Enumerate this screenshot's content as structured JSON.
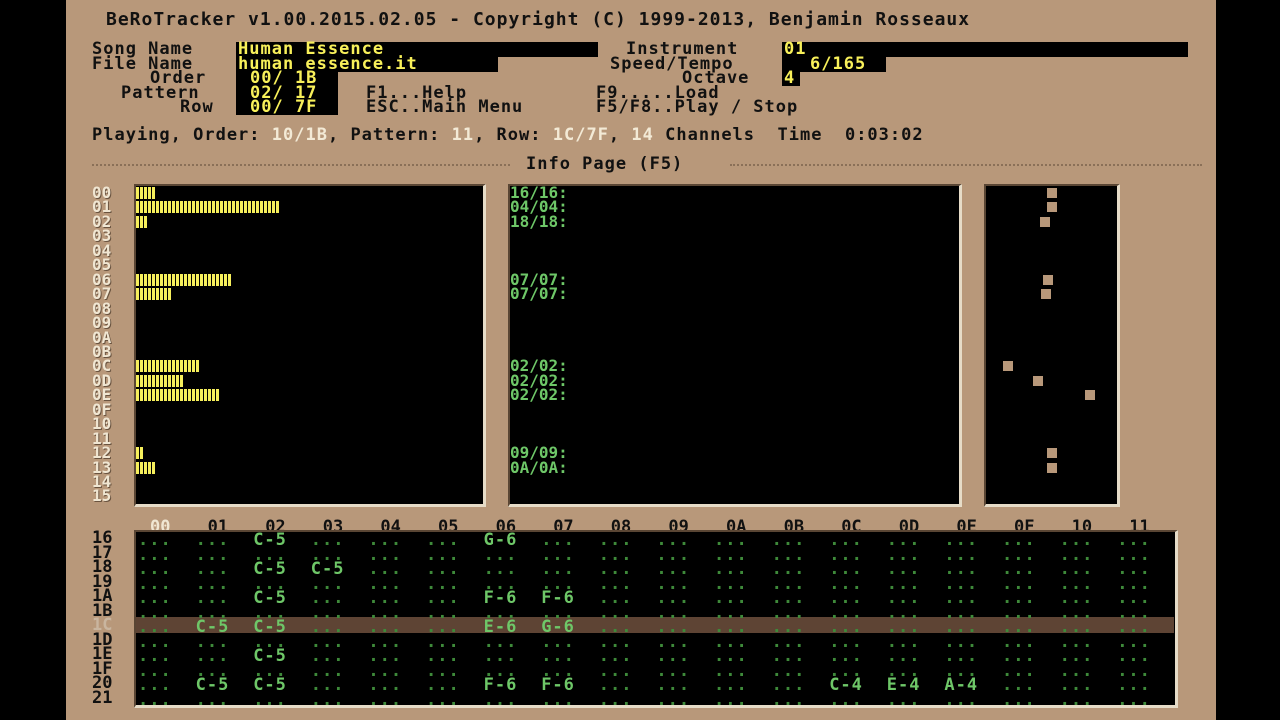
{
  "title": "BeRoTracker v1.00.2015.02.05 - Copyright (C) 1999-2013, Benjamin Rosseaux",
  "fields": {
    "song_name_label": "Song Name",
    "song_name": "Human Essence",
    "file_name_label": "File Name",
    "file_name": "human essence.it",
    "order_label": "Order",
    "order_value": "00/ 1B",
    "pattern_label": "Pattern",
    "pattern_value": "02/ 17",
    "row_label": "Row",
    "row_value": "00/ 7F",
    "instrument_label": "Instrument",
    "instrument_value": "01",
    "speed_label": "Speed/Tempo",
    "speed_value": "6/165",
    "octave_label": "Octave",
    "octave_value": "4"
  },
  "shortcuts": {
    "f1": "F1...Help",
    "esc": "ESC..Main Menu",
    "f9": "F9.....Load",
    "f5f8": "F5/F8..Play / Stop"
  },
  "status": {
    "playing_label": "Playing, Order:",
    "order": "10/1B",
    "pattern_label": ", Pattern:",
    "pattern": "11",
    "row_label": ", Row:",
    "row": "1C/7F",
    "channels_count": "14",
    "channels_label": "Channels",
    "time_label": "Time",
    "time": "0:03:02"
  },
  "info_page_title": "Info Page (F5)",
  "channel_rows": [
    "00",
    "01",
    "02",
    "03",
    "04",
    "05",
    "06",
    "07",
    "08",
    "09",
    "0A",
    "0B",
    "0C",
    "0D",
    "0E",
    "0F",
    "10",
    "11",
    "12",
    "13",
    "14",
    "15"
  ],
  "vu_levels": [
    5,
    36,
    3,
    0,
    0,
    0,
    24,
    9,
    0,
    0,
    0,
    0,
    16,
    12,
    21,
    0,
    0,
    0,
    2,
    5,
    0,
    0
  ],
  "vu_texts": [
    "16/16:",
    "04/04:",
    "18/18:",
    "",
    "",
    "",
    "07/07:",
    "07/07:",
    "",
    "",
    "",
    "",
    "02/02:",
    "02/02:",
    "02/02:",
    "",
    "",
    "",
    "09/09:",
    "0A/0A:",
    "",
    ""
  ],
  "pan_positions": [
    0.51,
    0.51,
    0.45,
    null,
    null,
    null,
    0.48,
    0.46,
    null,
    null,
    null,
    null,
    0.17,
    0.4,
    0.8,
    null,
    null,
    null,
    0.51,
    0.51,
    null,
    null
  ],
  "pattern": {
    "channels": [
      "00",
      "01",
      "02",
      "03",
      "04",
      "05",
      "06",
      "07",
      "08",
      "09",
      "0A",
      "0B",
      "0C",
      "0D",
      "0E",
      "0F",
      "10",
      "11"
    ],
    "rows": [
      "16",
      "17",
      "18",
      "19",
      "1A",
      "1B",
      "1C",
      "1D",
      "1E",
      "1F",
      "20",
      "21"
    ],
    "current_row": "1C",
    "cells": [
      [
        "...",
        "...",
        "C-5",
        "...",
        "...",
        "...",
        "G-6",
        "...",
        "...",
        "...",
        "...",
        "...",
        "...",
        "...",
        "...",
        "...",
        "...",
        "..."
      ],
      [
        "...",
        "...",
        "...",
        "...",
        "...",
        "...",
        "...",
        "...",
        "...",
        "...",
        "...",
        "...",
        "...",
        "...",
        "...",
        "...",
        "...",
        "..."
      ],
      [
        "...",
        "...",
        "C-5",
        "C-5",
        "...",
        "...",
        "...",
        "...",
        "...",
        "...",
        "...",
        "...",
        "...",
        "...",
        "...",
        "...",
        "...",
        "..."
      ],
      [
        "...",
        "...",
        "...",
        "...",
        "...",
        "...",
        "...",
        "...",
        "...",
        "...",
        "...",
        "...",
        "...",
        "...",
        "...",
        "...",
        "...",
        "..."
      ],
      [
        "...",
        "...",
        "C-5",
        "...",
        "...",
        "...",
        "F-6",
        "F-6",
        "...",
        "...",
        "...",
        "...",
        "...",
        "...",
        "...",
        "...",
        "...",
        "..."
      ],
      [
        "...",
        "...",
        "...",
        "...",
        "...",
        "...",
        "...",
        "...",
        "...",
        "...",
        "...",
        "...",
        "...",
        "...",
        "...",
        "...",
        "...",
        "..."
      ],
      [
        "...",
        "C-5",
        "C-5",
        "...",
        "...",
        "...",
        "E-6",
        "G-6",
        "...",
        "...",
        "...",
        "...",
        "...",
        "...",
        "...",
        "...",
        "...",
        "..."
      ],
      [
        "...",
        "...",
        "...",
        "...",
        "...",
        "...",
        "...",
        "...",
        "...",
        "...",
        "...",
        "...",
        "...",
        "...",
        "...",
        "...",
        "...",
        "..."
      ],
      [
        "...",
        "...",
        "C-5",
        "...",
        "...",
        "...",
        "...",
        "...",
        "...",
        "...",
        "...",
        "...",
        "...",
        "...",
        "...",
        "...",
        "...",
        "..."
      ],
      [
        "...",
        "...",
        "...",
        "...",
        "...",
        "...",
        "...",
        "...",
        "...",
        "...",
        "...",
        "...",
        "...",
        "...",
        "...",
        "...",
        "...",
        "..."
      ],
      [
        "...",
        "C-5",
        "C-5",
        "...",
        "...",
        "...",
        "F-6",
        "F-6",
        "...",
        "...",
        "...",
        "...",
        "C-4",
        "E-4",
        "A-4",
        "...",
        "...",
        "..."
      ],
      [
        "...",
        "...",
        "...",
        "...",
        "...",
        "...",
        "...",
        "...",
        "...",
        "...",
        "...",
        "...",
        "...",
        "...",
        "...",
        "...",
        "...",
        "..."
      ]
    ]
  },
  "colors": {
    "background": "#b8987a",
    "panel": "#000000",
    "highlight": "#f8f05a",
    "note": "#6ec768"
  }
}
